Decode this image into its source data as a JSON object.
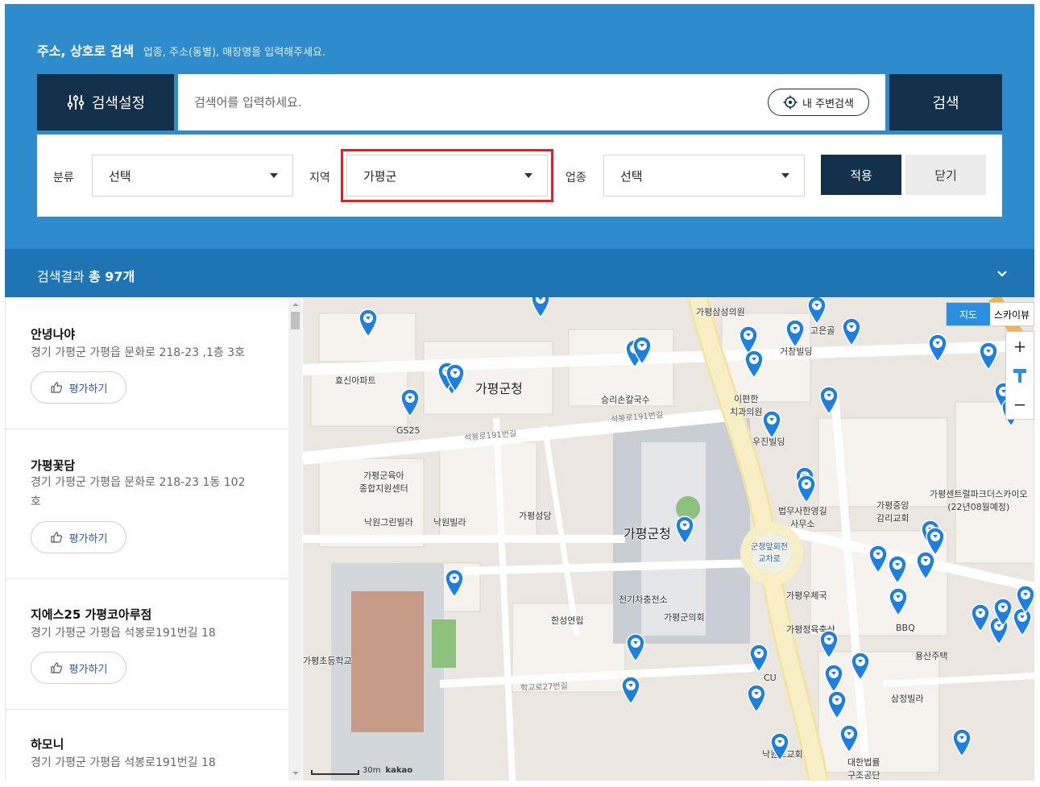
{
  "search": {
    "heading": "주소, 상호로 검색",
    "hint": "업종, 주소(동별), 매장명을 입력해주세요.",
    "settings_label": "검색설정",
    "placeholder": "검색어를 입력하세요.",
    "nearby_label": "내 주변검색",
    "search_label": "검색"
  },
  "filters": {
    "category_label": "분류",
    "category_value": "선택",
    "region_label": "지역",
    "region_value": "가평군",
    "industry_label": "업종",
    "industry_value": "선택",
    "apply_label": "적용",
    "close_label": "닫기"
  },
  "results": {
    "prefix": "검색결과",
    "count_text": "총 97개"
  },
  "list": {
    "rate_label": "평가하기",
    "items": [
      {
        "name": "안녕나야",
        "address": "경기 가평군 가평읍 문화로 218-23 ,1층 3호"
      },
      {
        "name": "가평꽃담",
        "address": "경기 가평군 가평읍 문화로 218-23 1동 102호"
      },
      {
        "name": "지에스25 가평코아루점",
        "address": "경기 가평군 가평읍 석봉로191번길 18"
      },
      {
        "name": "하모니",
        "address": "경기 가평군 가평읍 석봉로191번길 18"
      }
    ]
  },
  "map": {
    "type_map": "지도",
    "type_sky": "스카이뷰",
    "zoom_in": "+",
    "zoom_out": "−",
    "scale_label": "30m",
    "brand": "kakao",
    "labels": {
      "county_office": "가평군청",
      "county_office_2": "가평군청",
      "apt": "효신아파트",
      "gs25": "GS25",
      "restaurant": "승리손칼국수",
      "dental": "이편한\n치과의원",
      "building": "우진빌딩",
      "support": "가평군육아\n종합지원센터",
      "villa1": "낙원그린빌라",
      "villa2": "낙원빌라",
      "church": "가평성당",
      "law": "법무사한영길\n사무소",
      "roundabout": "군청앞회전\n교차로",
      "post": "가평우체국",
      "ev": "전기차충전소",
      "council": "가평군의회",
      "school": "가평초등학교",
      "hansung": "한성연립",
      "gym": "가평정육축산",
      "cu": "CU",
      "church2": "낙원로교회",
      "legal": "대한법률\n구조공단",
      "samjeong": "삼정빌라",
      "yongsan": "용산주택",
      "bbq": "BBQ",
      "methodist": "가평중앙\n감리교회",
      "central_park": "가평센트럴파크더스카이오\n(22년08월예정)",
      "goeun": "고은골",
      "geochang": "거창빌딩",
      "clinic": "가평삼성의원",
      "road1": "석봉로191번길",
      "road2": "석봉로191번길",
      "road3": "학교로27번길"
    }
  }
}
